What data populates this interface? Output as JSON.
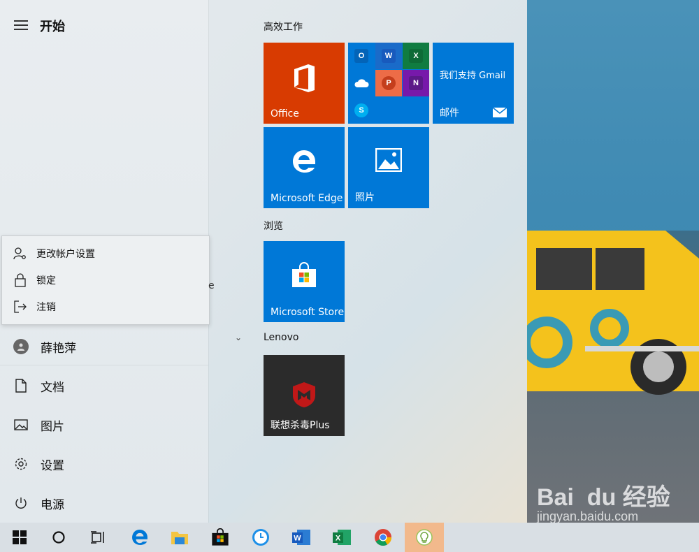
{
  "start": {
    "title": "开始",
    "menu_icon": "hamburger-icon"
  },
  "account_flyout": {
    "items": [
      {
        "label": "更改帐户设置",
        "icon": "account-settings-icon"
      },
      {
        "label": "锁定",
        "icon": "lock-icon"
      },
      {
        "label": "注销",
        "icon": "sign-out-icon"
      }
    ]
  },
  "rail": {
    "user": "薛艳萍",
    "documents": "文档",
    "pictures": "图片",
    "settings": "设置",
    "power": "电源",
    "partial_letter": "e"
  },
  "groups": {
    "productivity": "高效工作",
    "browse": "浏览",
    "lenovo": "Lenovo"
  },
  "tiles": {
    "office": "Office",
    "gmail_text": "我们支持 Gmail",
    "mail": "邮件",
    "edge": "Microsoft Edge",
    "photos": "照片",
    "store": "Microsoft Store",
    "mcafee": "联想杀毒Plus"
  },
  "mini_apps": [
    "O",
    "W",
    "X",
    "",
    "P",
    "N",
    "S"
  ],
  "watermark": {
    "main": "Bai  du 经验",
    "sub": "jingyan.baidu.com"
  },
  "taskbar": [
    "windows-start-icon",
    "cortana-icon",
    "task-view-icon",
    "edge-icon",
    "file-explorer-icon",
    "store-icon",
    "clock-app-icon",
    "word-icon",
    "excel-icon",
    "chrome-icon",
    "lightbulb-app-icon"
  ],
  "colors": {
    "office": "#d83b01",
    "blue_tile": "#0078d7",
    "dark_tile": "#2b2b2b",
    "taskbar_active": "#f2b98c"
  }
}
